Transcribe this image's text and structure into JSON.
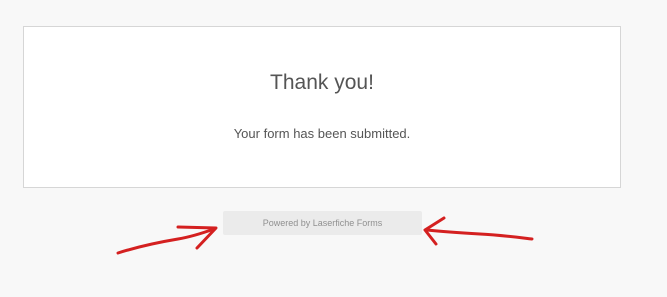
{
  "confirmation": {
    "title": "Thank you!",
    "message": "Your form has been submitted."
  },
  "footer": {
    "powered_by": "Powered by Laserfiche Forms"
  },
  "annotations": {
    "color": "#d42020"
  }
}
